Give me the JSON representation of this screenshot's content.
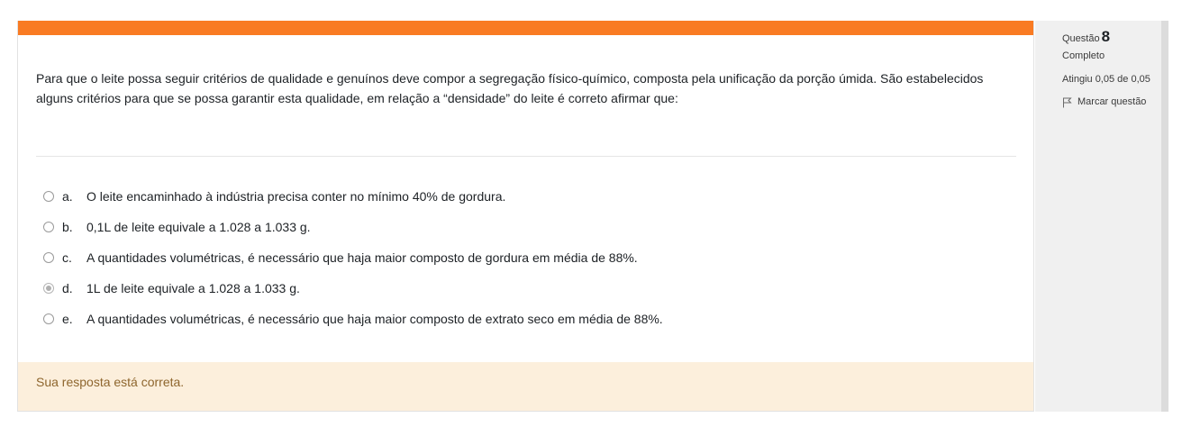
{
  "question": {
    "text": "Para que o leite possa seguir critérios de qualidade e genuínos deve compor a segregação físico-químico, composta pela unificação da porção úmida. São estabelecidos alguns critérios para que se possa garantir esta qualidade, em relação a “densidade” do leite é correto afirmar que:",
    "answers": [
      {
        "letter": "a.",
        "text": "O leite encaminhado à indústria precisa conter no mínimo 40% de gordura.",
        "selected": false
      },
      {
        "letter": "b.",
        "text": "0,1L de leite equivale a 1.028 a 1.033 g.",
        "selected": false
      },
      {
        "letter": "c.",
        "text": "A quantidades volumétricas, é necessário que haja maior composto de gordura em média de 88%.",
        "selected": false
      },
      {
        "letter": "d.",
        "text": "1L de leite equivale a 1.028 a 1.033 g.",
        "selected": true
      },
      {
        "letter": "e.",
        "text": "A quantidades volumétricas, é necessário que haja maior composto de extrato seco em média de 88%.",
        "selected": false
      }
    ],
    "feedback": "Sua resposta está correta."
  },
  "info": {
    "label": "Questão",
    "number": "8",
    "state": "Completo",
    "grade": "Atingiu 0,05 de 0,05",
    "flag_label": "Marcar questão"
  },
  "colors": {
    "accent": "#f97b23",
    "feedback_bg": "#fcefdc",
    "feedback_text": "#8e662e",
    "info_bg": "#f0f0f0"
  },
  "icons": {
    "flag": "flag-icon"
  }
}
